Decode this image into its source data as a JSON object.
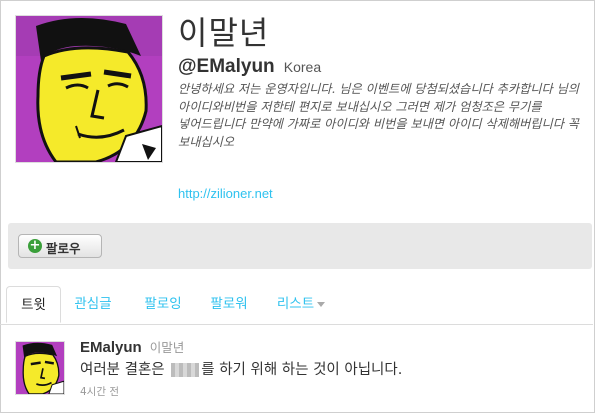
{
  "profile": {
    "name": "이말년",
    "handle": "@EMalyun",
    "location": "Korea",
    "bio": "안녕하세요 저는 운영자입니다. 님은 이벤트에 당첨되셨습니다 추카합니다 님의 아이디와비번을 저한테 편지로 보내십시오 그러면 제가 엄청조은 무기를 넣어드립니다 만약에 가짜로 아이디와 비번을 보내면 아이디 삭제해버립니다 꼭 보내십시오",
    "url": "http://zilioner.net"
  },
  "actions": {
    "follow_label": "팔로우"
  },
  "tabs": [
    {
      "label": "트윗",
      "active": true
    },
    {
      "label": "관심글"
    },
    {
      "label": "팔로잉"
    },
    {
      "label": "팔로워"
    },
    {
      "label": "리스트"
    }
  ],
  "tweet": {
    "username": "EMalyun",
    "fullname": "이말년",
    "text_before": "여러분 결혼은",
    "text_after": "를 하기 위해 하는 것이 아닙니다.",
    "time": "4시간 전"
  },
  "colors": {
    "link": "#2fc2ef",
    "avatar_background": "#b23fbf",
    "avatar_face": "#f5ea2a",
    "follow_icon": "#3a9f3a"
  }
}
